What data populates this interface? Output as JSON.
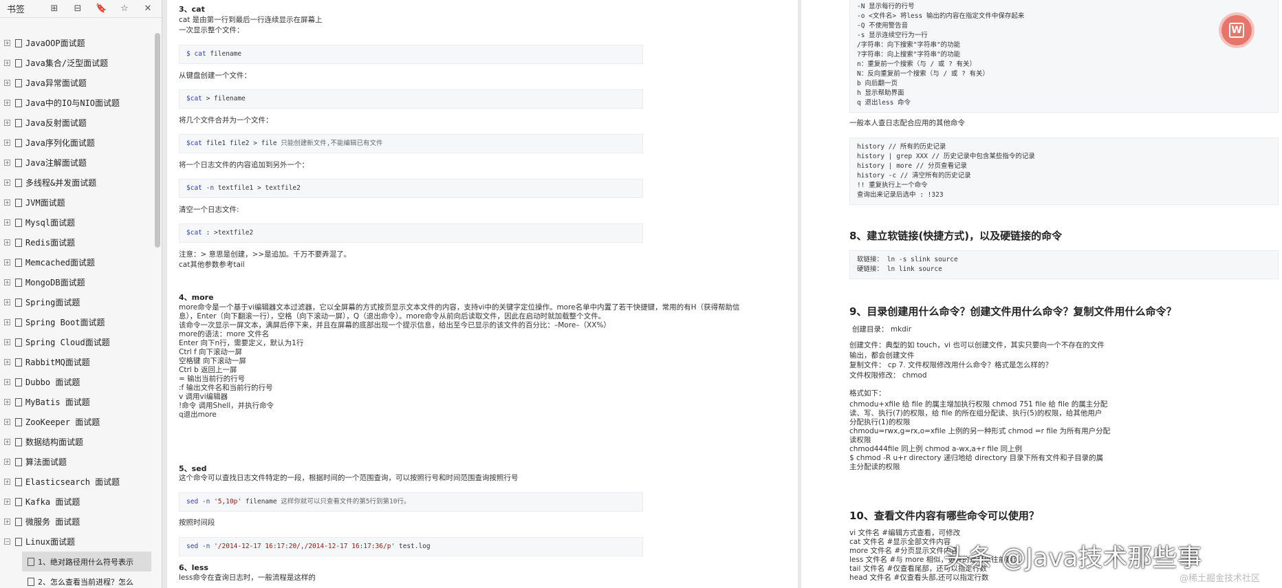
{
  "sidebar": {
    "title": "书签",
    "tools": [
      "⊞",
      "⊟",
      "🔖",
      "☆",
      "✕"
    ],
    "items": [
      {
        "label": "JavaOOP面试题"
      },
      {
        "label": "Java集合/泛型面试题"
      },
      {
        "label": "Java异常面试题"
      },
      {
        "label": "Java中的IO与NIO面试题"
      },
      {
        "label": "Java反射面试题"
      },
      {
        "label": "Java序列化面试题"
      },
      {
        "label": "Java注解面试题"
      },
      {
        "label": "多线程&并发面试题"
      },
      {
        "label": "JVM面试题"
      },
      {
        "label": "Mysql面试题"
      },
      {
        "label": "Redis面试题"
      },
      {
        "label": "Memcached面试题"
      },
      {
        "label": "MongoDB面试题"
      },
      {
        "label": "Spring面试题"
      },
      {
        "label": "Spring Boot面试题"
      },
      {
        "label": "Spring Cloud面试题"
      },
      {
        "label": "RabbitMQ面试题"
      },
      {
        "label": "Dubbo 面试题"
      },
      {
        "label": "MyBatis 面试题"
      },
      {
        "label": "ZooKeeper 面试题"
      },
      {
        "label": "数据结构面试题"
      },
      {
        "label": "算法面试题"
      },
      {
        "label": "Elasticsearch 面试题"
      },
      {
        "label": "Kafka 面试题"
      },
      {
        "label": "微服务 面试题"
      },
      {
        "label": "Linux面试题"
      }
    ],
    "sub_items": [
      {
        "label": "1、绝对路径用什么符号表示"
      },
      {
        "label": "2、怎么查看当前进程？怎么"
      }
    ]
  },
  "page1": {
    "cat_h": "3、cat",
    "cat_l1": "cat 是由第一行到最后一行连续显示在屏幕上",
    "cat_l2": "一次显示整个文件：",
    "code1": "$ cat filename",
    "cat_l3": "从键盘创建一个文件：",
    "code2": "$cat > filename",
    "cat_l4": "将几个文件合并为一个文件：",
    "code3": "$cat file1 file2 > file 只能创建新文件,不能编辑已有文件",
    "cat_l5": "将一个日志文件的内容追加到另外一个：",
    "code4": "$cat -n textfile1 > textfile2",
    "cat_l6": "清空一个日志文件:",
    "code5": "$cat : >textfile2",
    "note1": "注意：> 意思是创建，>>是追加。千万不要弄混了。",
    "note2": "cat其他参数参考tail",
    "more_h": "4、more",
    "more_lines": [
      "more命令是一个基于vi编辑器文本过滤器，它以全屏幕的方式按页显示文本文件的内容，支持vi中的关键字定位操作。more名单中内置了若干快捷键，常用的有H（获得帮助信",
      "息），Enter（向下翻滚一行），空格（向下滚动一屏），Q（退出命令）。more命令从前向后读取文件，因此在启动时就加载整个文件。",
      "该命令一次显示一屏文本，满屏后停下来，并且在屏幕的底部出现一个提示信息，给出至今已显示的该文件的百分比：–More–（XX%）",
      "more的语法：more 文件名",
      "Enter 向下n行，需要定义，默认为1行",
      "Ctrl f 向下滚动一屏",
      "空格键 向下滚动一屏",
      "Ctrl b 返回上一屏",
      "= 输出当前行的行号",
      ":f 输出文件名和当前行的行号",
      "v 调用vi编辑器",
      "!命令 调用Shell，并执行命令",
      "q退出more"
    ],
    "sed_h": "5、sed",
    "sed_l1": "这个命令可以查找日志文件特定的一段，根据时间的一个范围查询，可以按照行号和时间范围查询按照行号",
    "code6": "sed -n '5,10p' filename 这样你就可以只查看文件的第5行到第10行。",
    "sed_l2": "按照时间段",
    "code7": "sed -n '/2014-12-17 16:17:20/,/2014-12-17 16:17:36/p' test.log",
    "less_h": "6、less",
    "less_l1": "less命令在查询日志时，一般流程是这样的"
  },
  "page2": {
    "code_top": "-N 显示每行的行号\n-o <文件名> 将less 输出的内容在指定文件中保存起来\n-Q 不使用警告音\n-s 显示连续空行为一行\n/字符串：向下搜索\"字符串\"的功能\n?字符串：向上搜索\"字符串\"的功能\nn：重复前一个搜索（与 / 或 ? 有关）\nN：反向重复前一个搜索（与 / 或 ? 有关）\nb 向后翻一页\nh 显示帮助界面\nq 退出less 命令",
    "log_l": "一般本人查日志配合应用的其他命令",
    "code_hist": "history // 所有的历史记录\nhistory | grep XXX // 历史记录中包含某些指令的记录\nhistory | more // 分页查看记录\nhistory -c // 清空所有的历史记录\n!! 重复执行上一个命令\n查询出来记录后选中 : !323",
    "h8": "8、建立软链接(快捷方式)，以及硬链接的命令",
    "code_ln": "软链接： ln -s slink source\n硬链接： ln link source",
    "h9": "9、目录创建用什么命令？创建文件用什么命令？复制文件用什么命令？",
    "mk": "创建目录： mkdir",
    "p9_lines": [
      "创建文件：典型的如 touch，vi 也可以创建文件，其实只要向一个不存在的文件",
      "输出，都会创建文件",
      "复制文件： cp 7. 文件权限修改用什么命令？格式是怎么样的？",
      "文件权限修改： chmod"
    ],
    "fmt": "格式如下：",
    "fmt_lines": [
      "chmodu+xfile 给 file 的属主增加执行权限 chmod 751 file 给 file 的属主分配",
      "读、写、执行(7)的权限，给 file 的所在组分配读、执行(5)的权限，给其他用户",
      "分配执行(1)的权限",
      "chmodu=rwx,g=rx,o=xfile 上例的另一种形式 chmod =r file 为所有用户分配",
      "读权限",
      "chmod444file 同上例 chmod a-wx,a+r file 同上例",
      "$ chmod -R u+r directory 递归地给 directory 目录下所有文件和子目录的属",
      "主分配读的权限"
    ],
    "h10": "10、查看文件内容有哪些命令可以使用？",
    "p10_lines": [
      "vi 文件名 #编辑方式查看，可修改",
      "cat 文件名 #显示全部文件内容",
      "more 文件名 #分页显示文件内容",
      "less 文件名 #与 more 相似，更好的是可以往前翻页",
      "tail 文件名 #仅查看尾部，还可以指定行数",
      "head 文件名 #仅查看头部,还可以指定行数"
    ]
  },
  "overlay": {
    "fab_icon": "W",
    "watermark": "头条 @Java技术那些事",
    "watermark2": "@稀土掘金技术社区"
  }
}
